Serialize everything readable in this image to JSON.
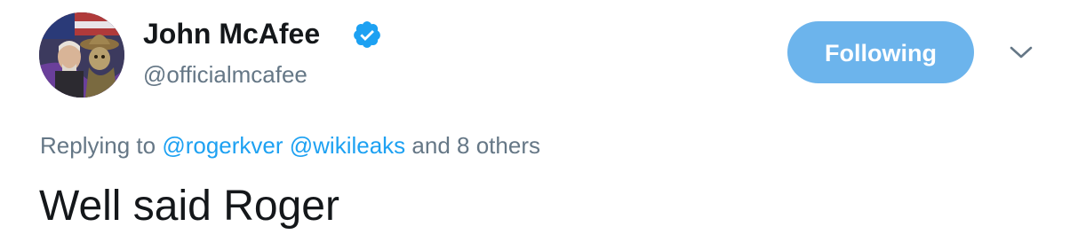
{
  "tweet": {
    "author": {
      "display_name": "John McAfee",
      "handle": "@officialmcafee",
      "verified": true,
      "verified_icon": "verified-badge-icon"
    },
    "follow_button": {
      "label": "Following"
    },
    "menu_icon": "chevron-down-icon",
    "reply_context": {
      "prefix": "Replying to",
      "mentions": [
        "@rogerkver",
        "@wikileaks"
      ],
      "suffix": "and 8 others"
    },
    "text": "Well said Roger"
  },
  "colors": {
    "link": "#1da1f2",
    "follow_button_bg": "#6cb4ec",
    "secondary_text": "#657786",
    "primary_text": "#14171a"
  }
}
